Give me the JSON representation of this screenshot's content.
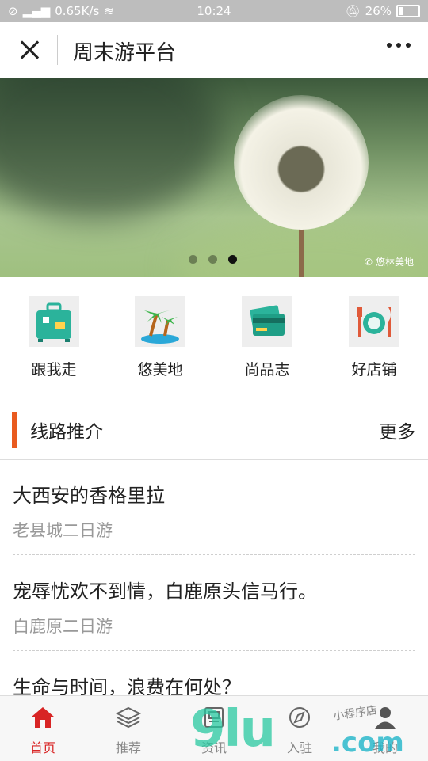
{
  "status_bar": {
    "speed": "0.65K/s",
    "time": "10:24",
    "battery": "26%",
    "battery_level": 0.26
  },
  "title_bar": {
    "title": "周末游平台"
  },
  "banner": {
    "watermark": "悠林美地",
    "active_dot": 3,
    "dot_count": 3
  },
  "categories": [
    {
      "label": "跟我走",
      "icon": "luggage-icon"
    },
    {
      "label": "悠美地",
      "icon": "palm-island-icon"
    },
    {
      "label": "尚品志",
      "icon": "cards-icon"
    },
    {
      "label": "好店铺",
      "icon": "dining-icon"
    }
  ],
  "section": {
    "title": "线路推介",
    "more": "更多"
  },
  "routes": [
    {
      "title": "大西安的香格里拉",
      "subtitle": "老县城二日游"
    },
    {
      "title": "宠辱忧欢不到情，白鹿原头信马行。",
      "subtitle": "白鹿原二日游"
    },
    {
      "title": "生命与时间，浪费在何处？",
      "subtitle": ""
    }
  ],
  "tabs": [
    {
      "label": "首页",
      "icon": "home-icon",
      "active": true
    },
    {
      "label": "推荐",
      "icon": "layers-icon",
      "active": false
    },
    {
      "label": "资讯",
      "icon": "news-icon",
      "active": false
    },
    {
      "label": "入驻",
      "icon": "compass-icon",
      "active": false
    },
    {
      "label": "我的",
      "icon": "user-icon",
      "active": false
    }
  ],
  "overlay_watermark": {
    "text": "9lu",
    "suffix": ".com",
    "tag": "小程序店"
  },
  "colors": {
    "accent": "#e95b1f",
    "active_tab": "#d82525",
    "icon_teal": "#2bb39b"
  }
}
